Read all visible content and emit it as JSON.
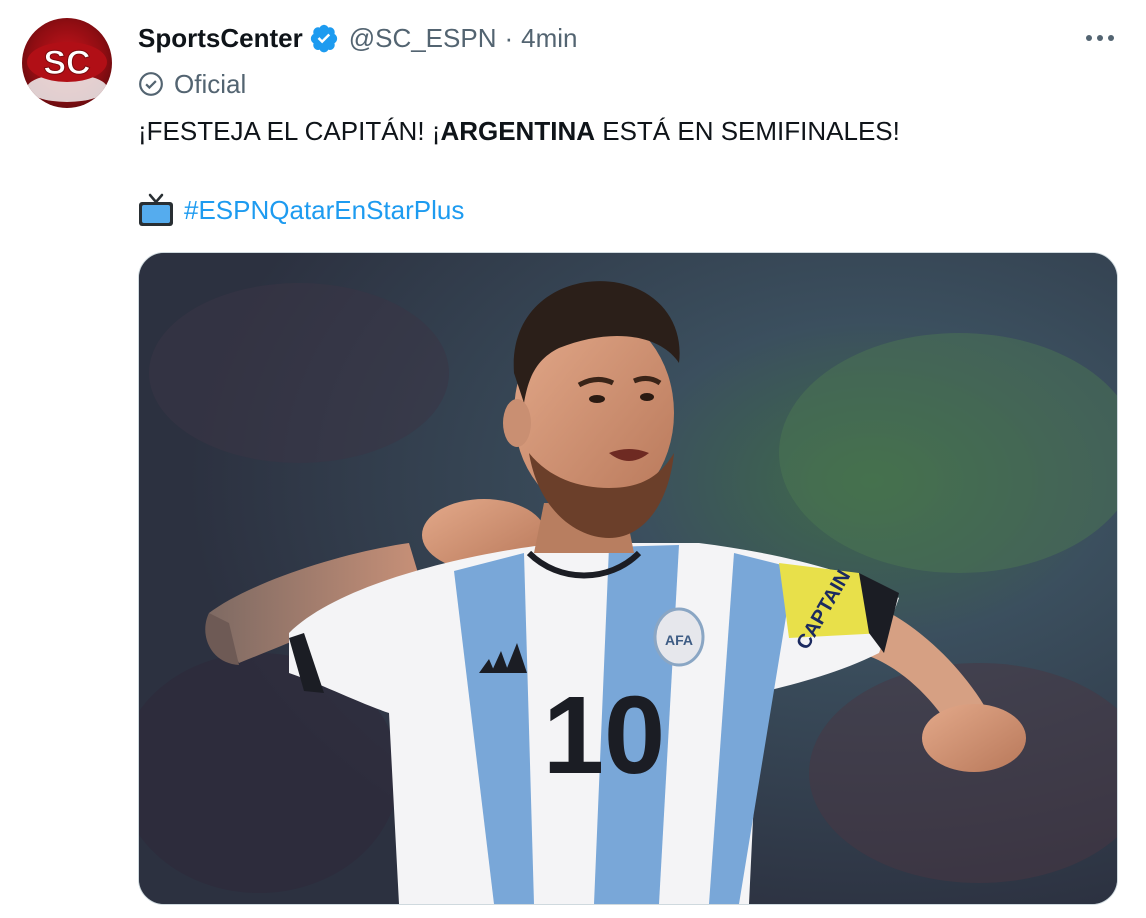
{
  "tweet": {
    "avatar_icon": "sportscenter-logo",
    "author_name": "SportsCenter",
    "verified_icon": "verified-badge-icon",
    "handle": "@SC_ESPN",
    "separator": "·",
    "time": "4min",
    "more_icon": "more-dots-icon",
    "official_label": "Oficial",
    "text_part1": "¡FESTEJA EL CAPITÁN! ¡",
    "text_bold": "ARGENTINA",
    "text_part2": " ESTÁ EN SEMIFINALES!",
    "tv_icon": "television-emoji",
    "hashtag": "#ESPNQatarEnStarPlus",
    "media_description_icon": "photo-player-celebrating",
    "jersey_number": "10"
  },
  "colors": {
    "link": "#1d9bf0",
    "secondary": "#536471",
    "verified": "#1d9bf0",
    "brand_red": "#c8141c"
  }
}
